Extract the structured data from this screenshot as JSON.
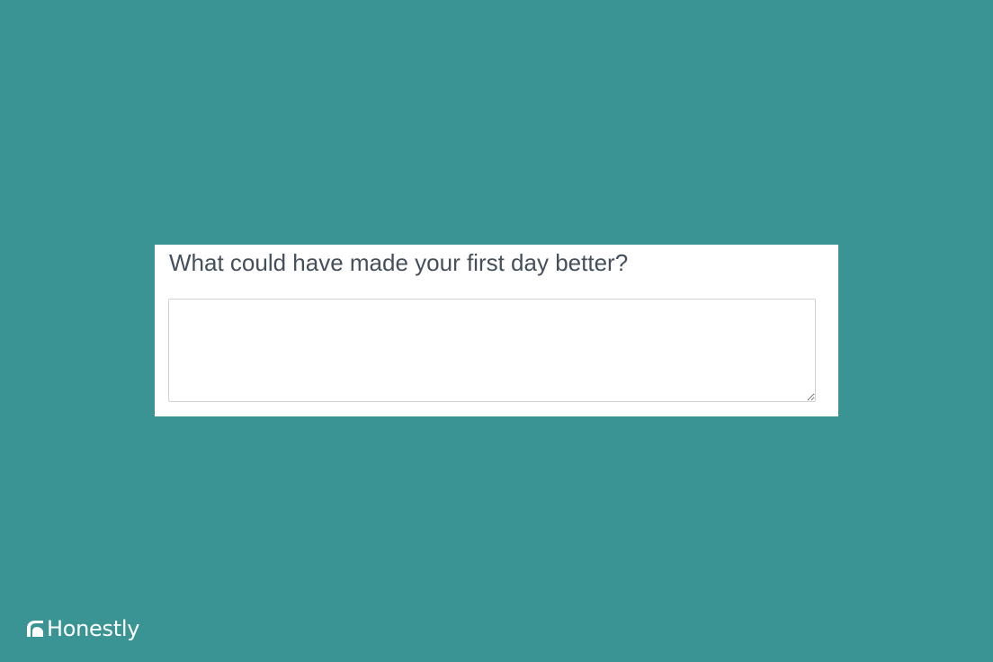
{
  "survey": {
    "question": "What could have made your first day better?",
    "answer_value": "",
    "answer_placeholder": ""
  },
  "branding": {
    "logo_icon": "honestly-logo-icon",
    "name": "Honestly"
  },
  "colors": {
    "background": "#3a9494",
    "card": "#ffffff",
    "question_text": "#454f5b",
    "field_border": "#cfd3d6",
    "brand_text": "#ffffff"
  }
}
